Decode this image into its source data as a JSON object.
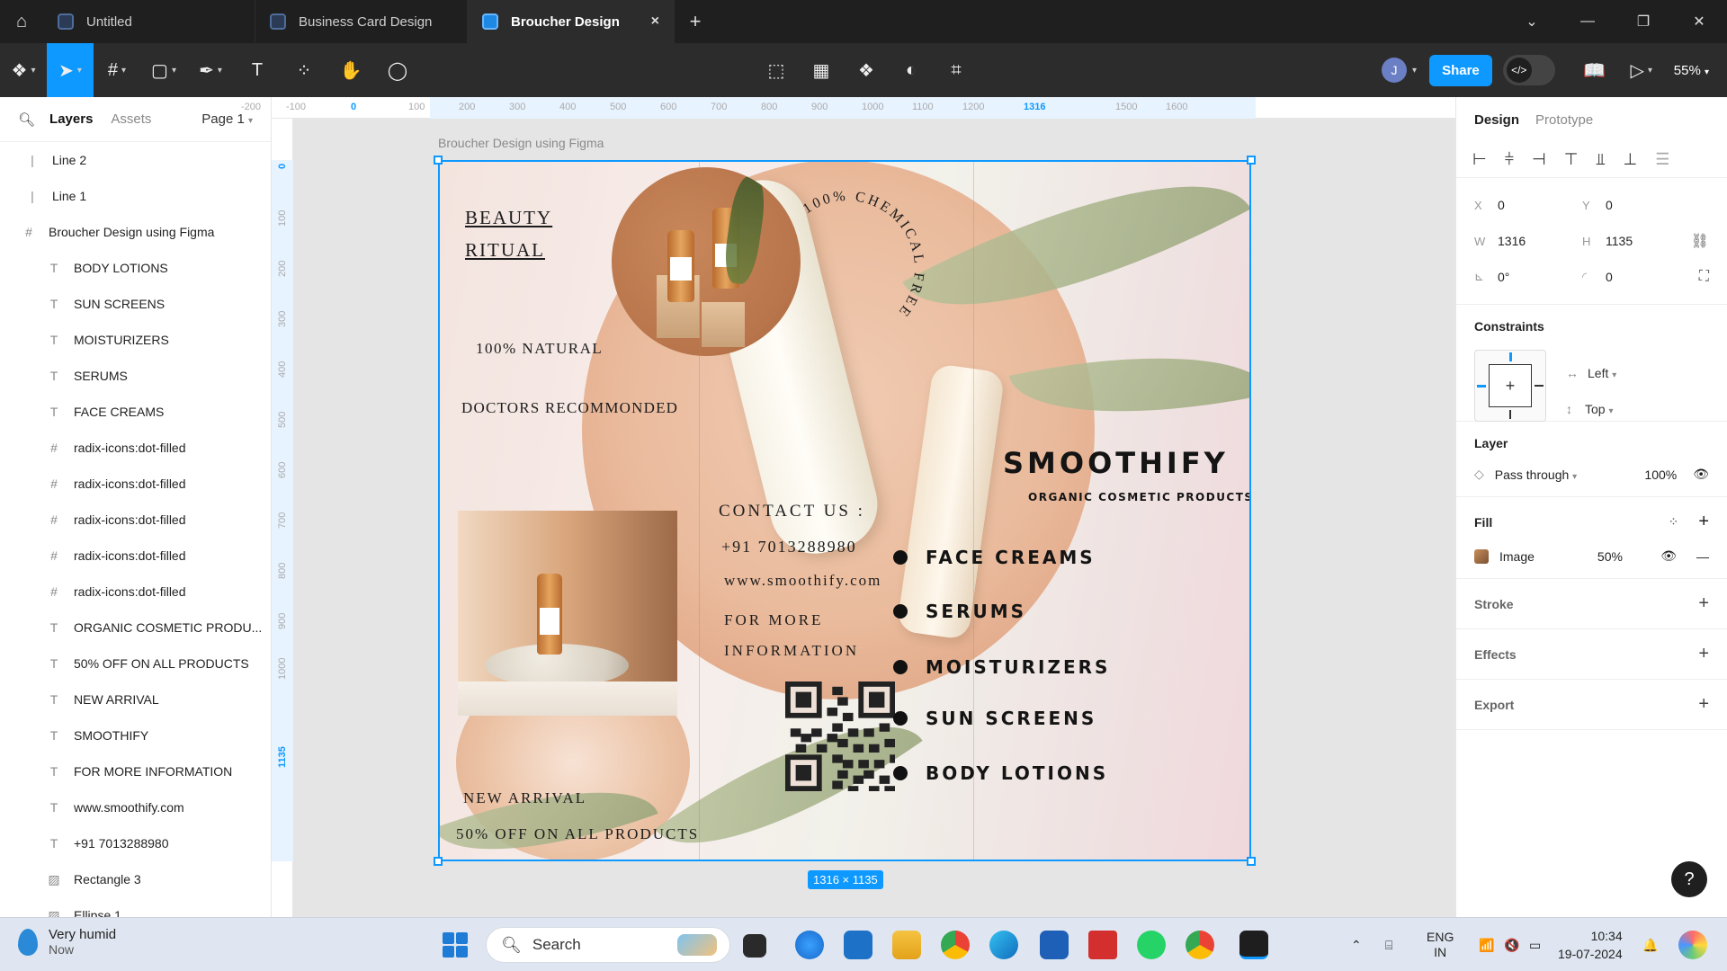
{
  "titlebar": {
    "tabs": [
      {
        "label": "Untitled"
      },
      {
        "label": "Business Card Design"
      },
      {
        "label": "Broucher Design"
      }
    ],
    "close_glyph": "×",
    "new_tab_glyph": "+"
  },
  "toolbar": {
    "avatar_initial": "J",
    "share_label": "Share",
    "dev_mode_glyph": "</>",
    "zoom": "55%"
  },
  "left_panel": {
    "tab_layers": "Layers",
    "tab_assets": "Assets",
    "page_selector": "Page 1",
    "layers": [
      {
        "name": "Line 2",
        "icon": "line-icon",
        "level": 0
      },
      {
        "name": "Line 1",
        "icon": "line-icon",
        "level": 0
      },
      {
        "name": "Broucher Design using Figma",
        "icon": "frame-icon",
        "level": 0
      },
      {
        "name": "BODY LOTIONS",
        "icon": "text-icon",
        "level": 1
      },
      {
        "name": "SUN SCREENS",
        "icon": "text-icon",
        "level": 1
      },
      {
        "name": "MOISTURIZERS",
        "icon": "text-icon",
        "level": 1
      },
      {
        "name": "SERUMS",
        "icon": "text-icon",
        "level": 1
      },
      {
        "name": "FACE CREAMS",
        "icon": "text-icon",
        "level": 1
      },
      {
        "name": "radix-icons:dot-filled",
        "icon": "frame-icon",
        "level": 1
      },
      {
        "name": "radix-icons:dot-filled",
        "icon": "frame-icon",
        "level": 1
      },
      {
        "name": "radix-icons:dot-filled",
        "icon": "frame-icon",
        "level": 1
      },
      {
        "name": "radix-icons:dot-filled",
        "icon": "frame-icon",
        "level": 1
      },
      {
        "name": "radix-icons:dot-filled",
        "icon": "frame-icon",
        "level": 1
      },
      {
        "name": "ORGANIC COSMETIC PRODU...",
        "icon": "text-icon",
        "level": 1
      },
      {
        "name": "50% OFF ON ALL PRODUCTS",
        "icon": "text-icon",
        "level": 1
      },
      {
        "name": "NEW ARRIVAL",
        "icon": "text-icon",
        "level": 1
      },
      {
        "name": "SMOOTHIFY",
        "icon": "text-icon",
        "level": 1
      },
      {
        "name": "FOR MORE INFORMATION",
        "icon": "text-icon",
        "level": 1
      },
      {
        "name": "www.smoothify.com",
        "icon": "text-icon",
        "level": 1
      },
      {
        "name": "+91 7013288980",
        "icon": "text-icon",
        "level": 1
      },
      {
        "name": "Rectangle 3",
        "icon": "image-icon",
        "level": 1
      },
      {
        "name": "Ellipse 1",
        "icon": "image-icon",
        "level": 1
      }
    ]
  },
  "rulers": {
    "top": [
      "-200",
      "-100",
      "0",
      "100",
      "200",
      "300",
      "400",
      "500",
      "600",
      "700",
      "800",
      "900",
      "1000",
      "1100",
      "1200",
      "1316",
      "1500",
      "1600"
    ],
    "top_highlight": [
      "0",
      "1316"
    ],
    "left": [
      "0",
      "100",
      "200",
      "300",
      "400",
      "500",
      "600",
      "700",
      "800",
      "900",
      "1000",
      "1135"
    ],
    "left_highlight": [
      "0",
      "1135"
    ]
  },
  "canvas": {
    "frame_label": "Broucher Design using Figma",
    "size_badge": "1316 × 1135",
    "brochure": {
      "beauty_line1": "BEAUTY",
      "beauty_line2": "RITUAL",
      "natural": "100% NATURAL",
      "doctors": "DOCTORS RECOMMONDED",
      "chemical_free": "100% CHEMICAL FREE",
      "contact_title": "CONTACT US :",
      "phone": "+91 7013288980",
      "website": "www.smoothify.com",
      "more_info_1": "FOR MORE",
      "more_info_2": "INFORMATION",
      "new_arrival": "NEW ARRIVAL",
      "offer": "50% OFF ON ALL PRODUCTS",
      "brand": "SMOOTHIFY",
      "tagline": "ORGANIC COSMETIC PRODUCTS",
      "products": [
        "FACE CREAMS",
        "SERUMS",
        "MOISTURIZERS",
        "SUN SCREENS",
        "BODY LOTIONS"
      ]
    }
  },
  "right_panel": {
    "tab_design": "Design",
    "tab_prototype": "Prototype",
    "x_label": "X",
    "x_value": "0",
    "y_label": "Y",
    "y_value": "0",
    "w_label": "W",
    "w_value": "1316",
    "h_label": "H",
    "h_value": "1135",
    "rotation": "0°",
    "radius": "0",
    "constraints_title": "Constraints",
    "constraint_h": "Left",
    "constraint_v": "Top",
    "layer_title": "Layer",
    "blend_mode": "Pass through",
    "layer_opacity": "100%",
    "fill_title": "Fill",
    "fill_type": "Image",
    "fill_opacity": "50%",
    "stroke_title": "Stroke",
    "effects_title": "Effects",
    "export_title": "Export",
    "help_glyph": "?"
  },
  "taskbar": {
    "weather_title": "Very humid",
    "weather_sub": "Now",
    "search_placeholder": "Search",
    "lang_1": "ENG",
    "lang_2": "IN",
    "time": "10:34",
    "date": "19-07-2024"
  },
  "colors": {
    "accent": "#0d99ff",
    "titlebar": "#1f1f1f",
    "toolbar": "#2c2c2c",
    "canvas": "#e5e5e5"
  }
}
